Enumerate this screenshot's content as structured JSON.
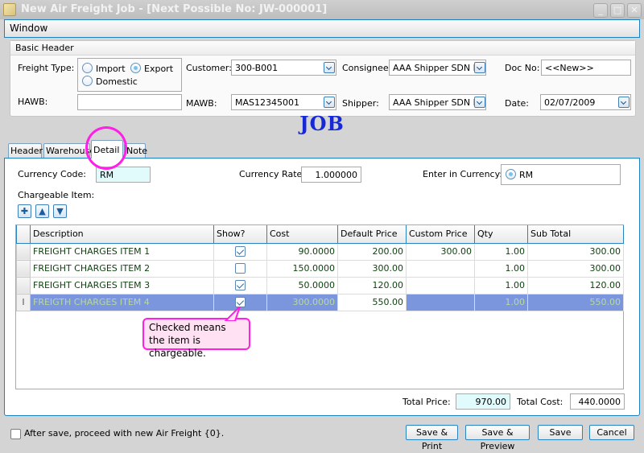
{
  "window": {
    "title": "New Air Freight Job  - [Next Possible No: JW-000001]",
    "controls": {
      "minimize": "_",
      "maximize": "□",
      "close": "✕"
    }
  },
  "menu": {
    "items": [
      {
        "label": "Window"
      }
    ]
  },
  "basic_header": {
    "title": "Basic Header",
    "freight_type": {
      "label": "Freight Type:",
      "options": [
        {
          "label": "Import",
          "selected": false
        },
        {
          "label": "Export",
          "selected": true
        },
        {
          "label": "Domestic",
          "selected": false
        }
      ]
    },
    "hawb": {
      "label": "HAWB:",
      "value": ""
    },
    "customer": {
      "label": "Customer:",
      "value": "300-B001"
    },
    "mawb": {
      "label": "MAWB:",
      "value": "MAS12345001"
    },
    "consignee": {
      "label": "Consignee:",
      "value": "AAA Shipper SDN BH"
    },
    "shipper": {
      "label": "Shipper:",
      "value": "AAA Shipper SDN BH"
    },
    "doc_no": {
      "label": "Doc No:",
      "value": "<<New>>"
    },
    "date": {
      "label": "Date:",
      "value": "02/07/2009"
    }
  },
  "banner": "JOB",
  "tabs": [
    {
      "label": "Header",
      "active": false
    },
    {
      "label": "Warehouse",
      "active": false
    },
    {
      "label": "Detail",
      "active": true
    },
    {
      "label": "Note",
      "active": false
    }
  ],
  "detail": {
    "currency_code": {
      "label": "Currency Code:",
      "value": "RM"
    },
    "currency_rate": {
      "label": "Currency Rate:",
      "value": "1.000000"
    },
    "enter_in_currency": {
      "label": "Enter in Currency:",
      "option": "RM",
      "selected": true
    },
    "chargeable_label": "Chargeable Item:",
    "toolbar": {
      "add": "add-icon",
      "move_up": "arrow-up-icon",
      "move_down": "arrow-down-icon"
    },
    "grid": {
      "columns": [
        "Description",
        "Show?",
        "Cost",
        "Default Price",
        "Custom Price",
        "Qty",
        "Sub Total"
      ],
      "rows": [
        {
          "description": "FREIGHT CHARGES ITEM 1",
          "show": true,
          "cost": "90.0000",
          "default_price": "200.00",
          "custom_price": "300.00",
          "qty": "1.00",
          "sub_total": "300.00",
          "selected": false
        },
        {
          "description": "FREIGHT CHARGES ITEM 2",
          "show": false,
          "cost": "150.0000",
          "default_price": "300.00",
          "custom_price": "",
          "qty": "1.00",
          "sub_total": "300.00",
          "selected": false
        },
        {
          "description": "FREIGHT CHARGES ITEM 3",
          "show": true,
          "cost": "50.0000",
          "default_price": "120.00",
          "custom_price": "",
          "qty": "1.00",
          "sub_total": "120.00",
          "selected": false
        },
        {
          "description": "FREIGTH CHARGES ITEM 4",
          "show": true,
          "cost": "300.0000",
          "default_price": "550.00",
          "custom_price": "",
          "qty": "1.00",
          "sub_total": "550.00",
          "selected": true,
          "row_marker": "I"
        }
      ]
    },
    "total_price": {
      "label": "Total Price:",
      "value": "970.00"
    },
    "total_cost": {
      "label": "Total Cost:",
      "value": "440.0000"
    }
  },
  "annotation": {
    "callout": "Checked means the item is chargeable.",
    "color": "#ff1fe6"
  },
  "footer": {
    "proceed_checkbox": {
      "label": "After save, proceed with new Air Freight {0}.",
      "checked": false
    },
    "buttons": {
      "save_print": "Save & Print",
      "save_preview": "Save & Preview",
      "save": "Save",
      "cancel": "Cancel"
    }
  }
}
